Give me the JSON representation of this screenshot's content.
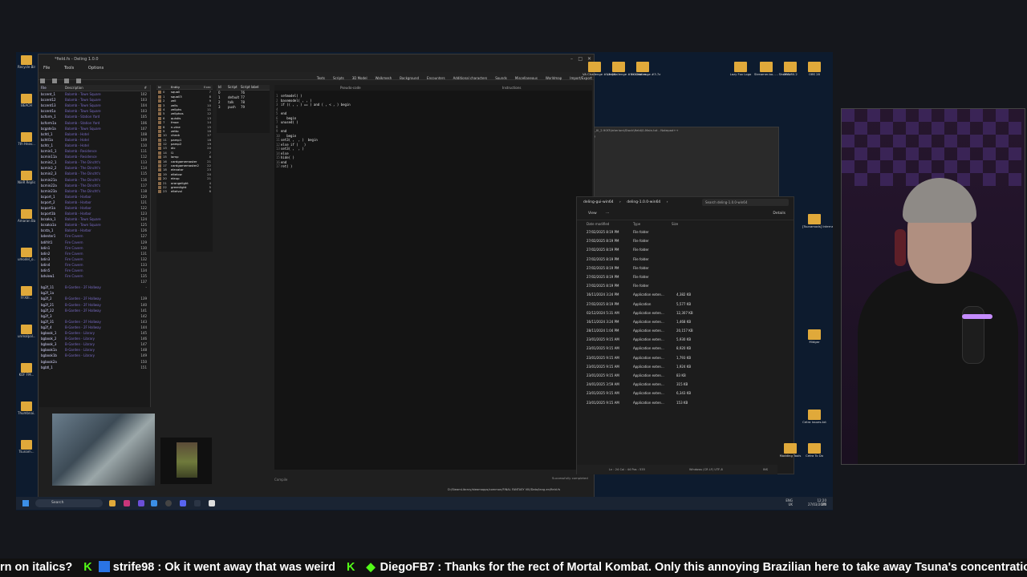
{
  "deling": {
    "title": "*field.fs - Deling 1.0.0",
    "menu": [
      "File",
      "Tools",
      "Options"
    ],
    "field_list": {
      "headers": [
        "File",
        "Description",
        "#"
      ],
      "rows": [
        [
          "bccent_1",
          "Balamb - Town Square",
          "102"
        ],
        [
          "bccent12",
          "Balamb - Town Square",
          "103"
        ],
        [
          "bccent13",
          "Balamb - Town Square",
          "104"
        ],
        [
          "bccent1a",
          "Balamb - Town Square",
          "103"
        ],
        [
          "bcform_1",
          "Balamb - Station Yard",
          "105"
        ],
        [
          "bcform1a",
          "Balamb - Station Yard",
          "106"
        ],
        [
          "bcgate1a",
          "Balamb - Town Square",
          "107"
        ],
        [
          "bchtl_1",
          "Balamb - Hotel",
          "108"
        ],
        [
          "bchtl1a",
          "Balamb - Hotel",
          "109"
        ],
        [
          "bchtr_1",
          "Balamb - Hotel",
          "110"
        ],
        [
          "bcmin1_1",
          "Balamb - Residence",
          "111"
        ],
        [
          "bcmin11a",
          "Balamb - Residence",
          "112"
        ],
        [
          "bcmin2_1",
          "Balamb - The Dincht's",
          "113"
        ],
        [
          "bcmin2_2",
          "Balamb - The Dincht's",
          "114"
        ],
        [
          "bcmin2_3",
          "Balamb - The Dincht's",
          "115"
        ],
        [
          "bcmin21a",
          "Balamb - The Dincht's",
          "116"
        ],
        [
          "bcmin22a",
          "Balamb - The Dincht's",
          "117"
        ],
        [
          "bcmin23a",
          "Balamb - The Dincht's",
          "118"
        ],
        [
          "bcport_1",
          "Balamb - Harbor",
          "120"
        ],
        [
          "bcport_2",
          "Balamb - Harbor",
          "121"
        ],
        [
          "bcport1a",
          "Balamb - Harbor",
          "122"
        ],
        [
          "bcport1b",
          "Balamb - Harbor",
          "123"
        ],
        [
          "bcsaka_1",
          "Balamb - Town Square",
          "124"
        ],
        [
          "bcsaka1a",
          "Balamb - Town Square",
          "125"
        ],
        [
          "bcsta_1",
          "Balamb - Harbor",
          "126"
        ],
        [
          "bdenter1",
          "Fire Cavern",
          "127"
        ],
        [
          "bdifrit1",
          "Fire Cavern",
          "129"
        ],
        [
          "bdin1",
          "Fire Cavern",
          "130"
        ],
        [
          "bdin2",
          "Fire Cavern",
          "131"
        ],
        [
          "bdin3",
          "Fire Cavern",
          "132"
        ],
        [
          "bdin4",
          "Fire Cavern",
          "133"
        ],
        [
          "bdin5",
          "Fire Cavern",
          "134"
        ],
        [
          "bdview1",
          "Fire Cavern",
          "135"
        ],
        [
          "",
          "",
          "137"
        ],
        [
          "bg2f_11",
          "B-Garden - 2F Hallway",
          "-"
        ],
        [
          "bg2f_1a",
          "",
          ""
        ],
        [
          "bg2f_2",
          "B-Garden - 2F Hallway",
          "139"
        ],
        [
          "bg2f_21",
          "B-Garden - 2F Hallway",
          "140"
        ],
        [
          "bg2f_22",
          "B-Garden - 2F Hallway",
          "141"
        ],
        [
          "bg2f_3",
          "",
          "142"
        ],
        [
          "bg2f_31",
          "B-Garden - 2F Hallway",
          "143"
        ],
        [
          "bg2f_4",
          "B-Garden - 2F Hallway",
          "144"
        ],
        [
          "bgbook_1",
          "B-Garden - Library",
          "145"
        ],
        [
          "bgbook_2",
          "B-Garden - Library",
          "146"
        ],
        [
          "bgbook_3",
          "B-Garden - Library",
          "147"
        ],
        [
          "bgbook1a",
          "B-Garden - Library",
          "148"
        ],
        [
          "bgbook1b",
          "B-Garden - Library",
          "149"
        ],
        [
          "bgbook2a",
          "",
          "150"
        ],
        [
          "bgbtl_1",
          "",
          "151"
        ]
      ]
    },
    "entity_list": {
      "headers": [
        "Id",
        "Entity",
        "Exec"
      ],
      "rows": [
        [
          "0",
          "squall",
          "7"
        ],
        [
          "1",
          "squall3",
          "8"
        ],
        [
          "2",
          "zell",
          "9"
        ],
        [
          "3",
          "zells",
          "10"
        ],
        [
          "4",
          "zellphs",
          "11"
        ],
        [
          "5",
          "zellphos",
          "12"
        ],
        [
          "6",
          "quistis",
          "13"
        ],
        [
          "7",
          "fmoe",
          "14"
        ],
        [
          "8",
          "n-vine",
          "15"
        ],
        [
          "9",
          "zetto",
          "16"
        ],
        [
          "10",
          "check",
          "17"
        ],
        [
          "11",
          "pamp1",
          "18"
        ],
        [
          "12",
          "pamp2",
          "19"
        ],
        [
          "13",
          "dic",
          "20"
        ],
        [
          "14",
          "l1",
          "7"
        ],
        [
          "15",
          "lamp",
          "8"
        ],
        [
          "16",
          "cardgamemaster",
          "21"
        ],
        [
          "17",
          "cardgamemaster2",
          "22"
        ],
        [
          "18",
          "elevator",
          "23"
        ],
        [
          "19",
          "eltelow",
          "20"
        ],
        [
          "20",
          "eleup",
          "21"
        ],
        [
          "21",
          "orangelight",
          "4"
        ],
        [
          "22",
          "greenlight",
          "5"
        ],
        [
          "23",
          "eltelvol",
          "6"
        ]
      ]
    },
    "script_list": {
      "headers": [
        "Id",
        "Script",
        "Script label"
      ],
      "rows": [
        [
          "0",
          "",
          "76"
        ],
        [
          "1",
          "default",
          "77"
        ],
        [
          "2",
          "talk",
          "78"
        ],
        [
          "3",
          "push",
          "79"
        ]
      ]
    },
    "tabs": [
      "Texts",
      "Scripts",
      "3D Model",
      "Walkmesh",
      "Background",
      "Encounters",
      "Additional characters",
      "Sounds",
      "Miscellaneous",
      "Worldmap",
      "Import/Export"
    ],
    "code_headers": {
      "left": "Pseudo-code",
      "right": "Instructions"
    },
    "code_lines": [
      [
        "1",
        "setmodel( )"
      ],
      [
        "2",
        "basemodel( , , )"
      ],
      [
        "3",
        "if (( , , ) == ) and ( , < , ) begin"
      ],
      [
        "4",
        ""
      ],
      [
        "5",
        "end"
      ],
      [
        "6",
        "   begin"
      ],
      [
        "7",
        "unused( )"
      ],
      [
        "8",
        ""
      ],
      [
        "9",
        "end"
      ],
      [
        "10",
        "   begin"
      ],
      [
        "11",
        "set3( ,  , )  begin"
      ],
      [
        "12",
        "else if (   )"
      ],
      [
        "13",
        "set3( ,  , )"
      ],
      [
        "14",
        "else"
      ],
      [
        "15",
        "hide( )"
      ],
      [
        "16",
        "end"
      ],
      [
        "17",
        "ret( )"
      ]
    ],
    "compile_label": "Compile",
    "status": "Successfully completed",
    "path": "D:/SteamLibrary/steamapps/common/FINAL FANTASY VIII/Data/lang-en/field.fs"
  },
  "explorer": {
    "breadcrumb": [
      "deling-gui-win64",
      "deling-1.0.0-win64"
    ],
    "search_placeholder": "Search deling-1.0.0-win64",
    "view_label": "View",
    "details_label": "Details",
    "headers": [
      "Date modified",
      "Type",
      "Size"
    ],
    "rows": [
      [
        "27/02/2025 8:19 PM",
        "File folder",
        ""
      ],
      [
        "27/02/2025 8:19 PM",
        "File folder",
        ""
      ],
      [
        "27/02/2025 8:19 PM",
        "File folder",
        ""
      ],
      [
        "27/02/2025 8:19 PM",
        "File folder",
        ""
      ],
      [
        "27/02/2025 8:19 PM",
        "File folder",
        ""
      ],
      [
        "27/02/2025 8:19 PM",
        "File folder",
        ""
      ],
      [
        "27/02/2025 8:19 PM",
        "File folder",
        ""
      ],
      [
        "16/11/2024 3:24 PM",
        "Application exten...",
        "4,382 KB"
      ],
      [
        "27/02/2025 8:19 PM",
        "Application",
        "5,577 KB"
      ],
      [
        "02/12/2024 5:31 AM",
        "Application exten...",
        "12,307 KB"
      ],
      [
        "16/11/2024 3:24 PM",
        "Application exten...",
        "1,468 KB"
      ],
      [
        "28/11/2024 1:04 PM",
        "Application exten...",
        "20,157 KB"
      ],
      [
        "23/01/2025 9:15 AM",
        "Application exten...",
        "5,930 KB"
      ],
      [
        "23/01/2025 9:15 AM",
        "Application exten...",
        "8,920 KB"
      ],
      [
        "23/01/2025 9:15 AM",
        "Application exten...",
        "1,793 KB"
      ],
      [
        "23/01/2025 9:15 AM",
        "Application exten...",
        "1,924 KB"
      ],
      [
        "23/01/2025 9:15 AM",
        "Application exten...",
        "83 KB"
      ],
      [
        "24/01/2025 3:59 AM",
        "Application exten...",
        "315 KB"
      ],
      [
        "23/01/2025 9:15 AM",
        "Application exten...",
        "6,343 KB"
      ],
      [
        "23/01/2025 9:15 AM",
        "Application exten...",
        "153 KB"
      ]
    ]
  },
  "notepad": {
    "title": "ed_Stock_III_2.90f3\\Interiors\\Stock\\field\\0-Main.txt - Notepad++",
    "menu": "Window  ?",
    "status": "Ln : 24  Col : 44  Pos : 535",
    "encoding": "Windows (CR LF)   UTF-8",
    "ins": "INS"
  },
  "desktop_right_icons": [
    {
      "label": "VA Challenge #1.mp4"
    },
    {
      "label": "VA Challenge #3 Guida.m..."
    },
    {
      "label": "Va Challenge #3.7z"
    },
    {
      "label": "Lazy Fox Logo"
    },
    {
      "label": "Streamer.bo... - Shortcut"
    },
    {
      "label": "OBS 30.2"
    },
    {
      "label": "OBS 28"
    },
    {
      "label": "[Tsunamods] Internation..."
    },
    {
      "label": "Midgar"
    },
    {
      "label": "Cetra issues.txt"
    },
    {
      "label": "Modding Tools"
    },
    {
      "label": "Cetra To Do"
    }
  ],
  "desktop_left_icons": [
    "Recycle Bin",
    "BEACH",
    "7th Heav...",
    "NieR Replicant",
    "Amaran Battle B...",
    "umodel_o...",
    "FFXIII...",
    "unrealpal...",
    "KOF FM...",
    "Thumbnai...",
    "Tsunam..."
  ],
  "taskbar": {
    "search_label": "Search",
    "lang": "ENG",
    "region": "UK",
    "time": "12:20 PM",
    "date": "27/03/2025"
  },
  "chat_ticker": {
    "segments": [
      {
        "user": "",
        "message": "rn on italics?"
      },
      {
        "user": "strife98",
        "message": ": Ok it went away that was weird"
      },
      {
        "user": "DiegoFB7",
        "message": ": Thanks for the rect of Mortal Kombat. Only this annoying Brazilian here to take away Tsuna's concentration. 😂"
      }
    ],
    "kick_color": "#53fc18"
  }
}
